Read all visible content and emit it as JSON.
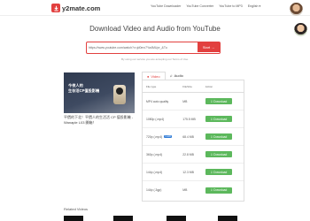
{
  "header": {
    "logo_text": "y2mate.com",
    "nav": [
      "YouTube Downloader",
      "YouTube Converter",
      "YouTube to MP3",
      "English ▾"
    ]
  },
  "main": {
    "title": "Download Video and Audio from YouTube",
    "search": {
      "value": "https://www.youtube.com/watch?v=jd0mx7Ya4MUpr_&Tu",
      "start_label": "Start →"
    },
    "terms": "By using our service you are accepting our Terms of Use."
  },
  "video": {
    "thumb_caption": "今夜人的\n生存活CP值投影機",
    "title": "平價的下北！平價人的生活活 CP 值投影機 - Wanaple L03 開箱！"
  },
  "tabs": {
    "video": "Video",
    "audio": "Audio"
  },
  "table": {
    "headers": [
      "File type",
      "FileSize",
      "Action"
    ],
    "rows": [
      {
        "type": "MP4 auto quality",
        "size": "MB",
        "hd": "",
        "action": "Download"
      },
      {
        "type": "1080p (.mp4)",
        "size": "175.5 MB",
        "hd": "",
        "action": "Download"
      },
      {
        "type": "720p (.mp4)",
        "size": "68.4 MB",
        "hd": "m-HD",
        "action": "Download"
      },
      {
        "type": "360p (.mp4)",
        "size": "22.8 MB",
        "hd": "",
        "action": "Download"
      },
      {
        "type": "144p (.mp4)",
        "size": "12.3 MB",
        "hd": "",
        "action": "Download"
      },
      {
        "type": "144p (.3gp)",
        "size": "MB",
        "hd": "",
        "action": "Download"
      }
    ]
  },
  "related": {
    "label": "Related Videos"
  },
  "colors": {
    "accent": "#e2403f",
    "download": "#5cb85c"
  }
}
